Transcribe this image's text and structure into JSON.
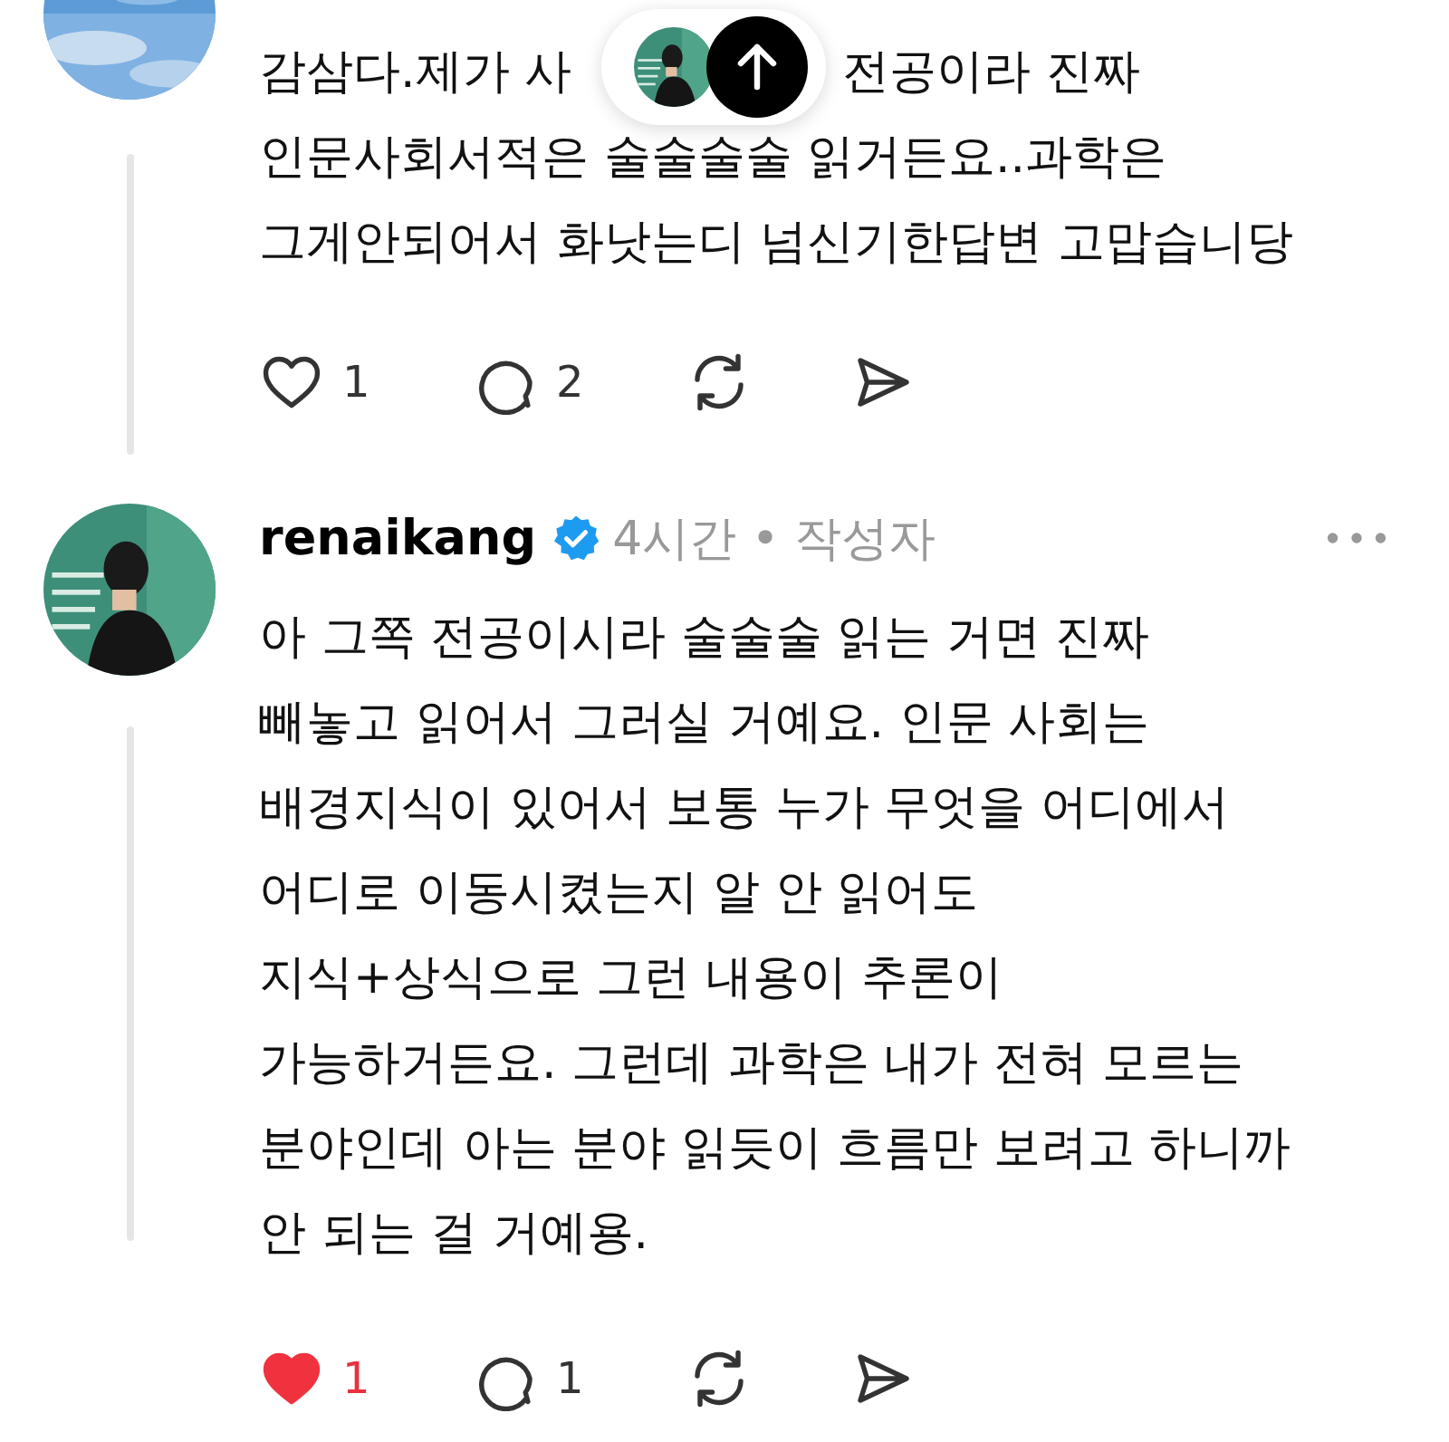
{
  "comments": [
    {
      "text_before_overlay": "감삼다.제가 사",
      "text_after_overlay": "전공이라 진짜",
      "text_rest": "인문사회서적은 술술술술 읽거든요..과학은\n그게안되어서 화낫는디 넘신기한답변 고맙습니당",
      "actions": {
        "liked": false,
        "like_count": "1",
        "reply_count": "2"
      }
    },
    {
      "username": "renaikang",
      "verified": true,
      "time": "4시간",
      "separator": "•",
      "role": "작성자",
      "has_more_menu": true,
      "text": "아 그쪽 전공이시라 술술술 읽는 거면 진짜\n빼놓고 읽어서 그러실 거예요. 인문 사회는\n배경지식이 있어서 보통 누가 무엇을 어디에서\n어디로 이동시켰는지 알 안 읽어도\n지식+상식으로 그런 내용이 추론이\n가능하거든요. 그런데 과학은 내가 전혀 모르는\n분야인데 아는 분야 읽듯이 흐름만 보려고 하니까\n안 되는 걸 거예용.",
      "actions": {
        "liked": true,
        "like_count": "1",
        "reply_count": "1"
      }
    }
  ]
}
